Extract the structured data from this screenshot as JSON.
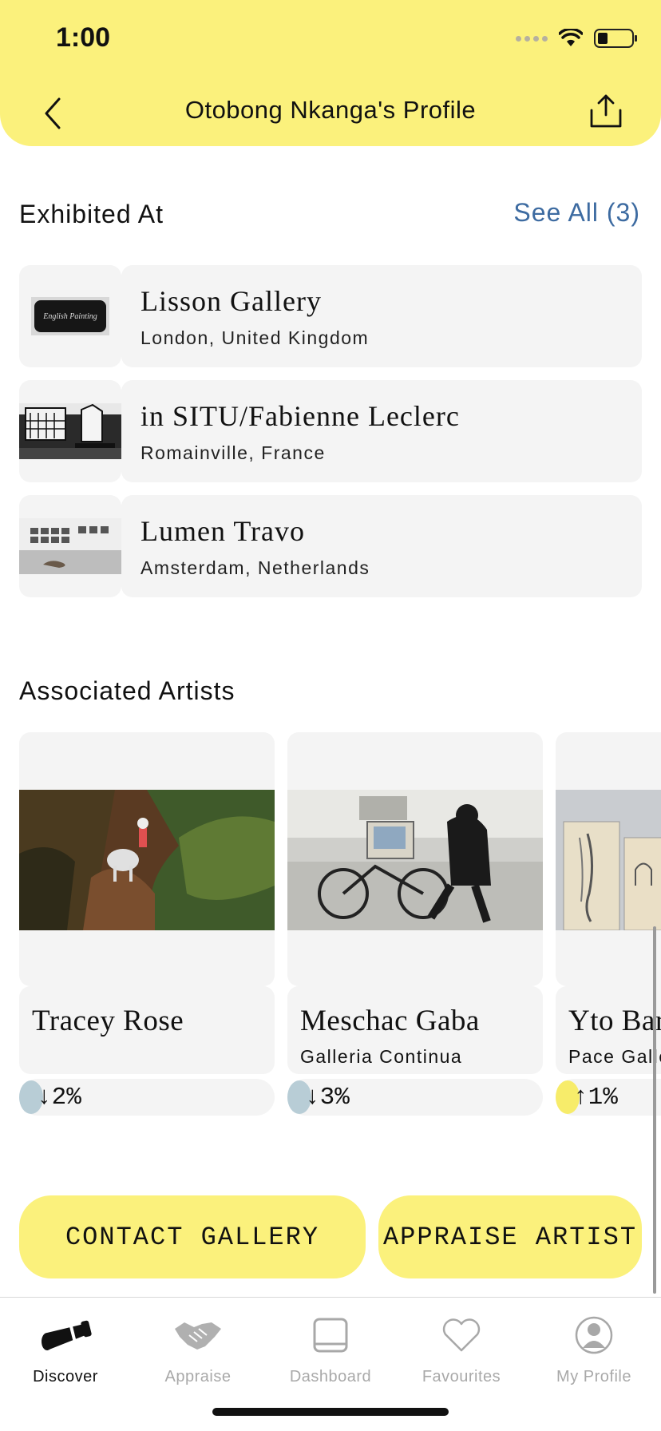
{
  "status_bar": {
    "time": "1:00"
  },
  "header": {
    "title": "Otobong Nkanga's Profile"
  },
  "exhibited": {
    "title": "Exhibited At",
    "see_all": "See All (3)",
    "items": [
      {
        "name": "Lisson Gallery",
        "location": "London, United Kingdom",
        "thumb_text": "English Painting"
      },
      {
        "name": "in SITU/Fabienne Leclerc",
        "location": "Romainville, France"
      },
      {
        "name": "Lumen Travo",
        "location": "Amsterdam, Netherlands"
      }
    ]
  },
  "associated": {
    "title": "Associated Artists",
    "artists": [
      {
        "name": "Tracey Rose",
        "gallery": "",
        "change": "↓2%",
        "dot_color": "#b8cdd6"
      },
      {
        "name": "Meschac Gaba",
        "gallery": "Galleria Continua",
        "change": "↓3%",
        "dot_color": "#b8cdd6"
      },
      {
        "name": "Yto Barrada",
        "gallery": "Pace Gallery",
        "change": "↑1%",
        "dot_color": "#f7ec6a"
      }
    ]
  },
  "actions": {
    "contact": "CONTACT GALLERY",
    "appraise": "APPRAISE ARTIST"
  },
  "tabs": [
    {
      "label": "Discover",
      "icon": "telescope-icon",
      "active": true
    },
    {
      "label": "Appraise",
      "icon": "handshake-icon",
      "active": false
    },
    {
      "label": "Dashboard",
      "icon": "dashboard-icon",
      "active": false
    },
    {
      "label": "Favourites",
      "icon": "heart-icon",
      "active": false
    },
    {
      "label": "My Profile",
      "icon": "profile-icon",
      "active": false
    }
  ],
  "colors": {
    "accent": "#fbf17c",
    "link": "#3d6ba1",
    "card": "#f4f4f4",
    "down": "#b8cdd6",
    "up": "#f7ec6a"
  }
}
